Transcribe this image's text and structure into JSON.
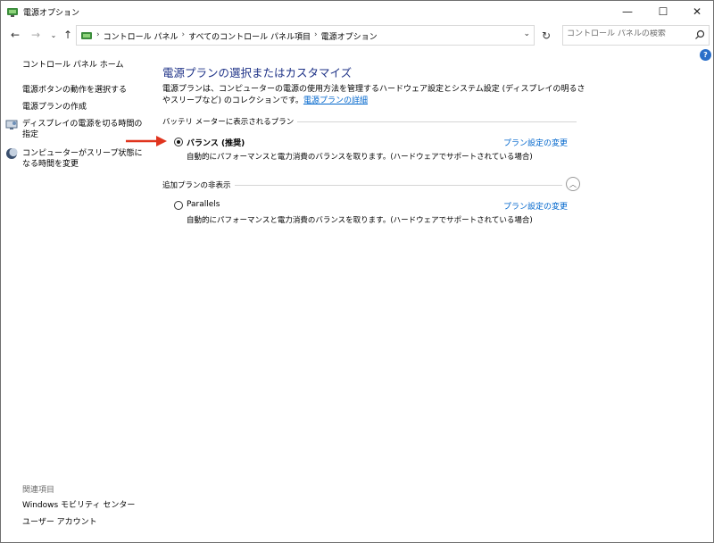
{
  "window": {
    "title": "電源オプション",
    "minimize_glyph": "—",
    "maximize_glyph": "☐",
    "close_glyph": "✕"
  },
  "nav": {
    "back_glyph": "←",
    "forward_glyph": "→",
    "recent_glyph": "⌄",
    "up_glyph": "↑",
    "refresh_glyph": "↻",
    "dropdown_glyph": "⌄"
  },
  "address": {
    "breadcrumbs": [
      "コントロール パネル",
      "すべてのコントロール パネル項目",
      "電源オプション"
    ],
    "separator": "›"
  },
  "search": {
    "placeholder": "コントロール パネルの検索"
  },
  "help": {
    "label": "?"
  },
  "sidebar": {
    "home": "コントロール パネル ホーム",
    "items": [
      {
        "label": "電源ボタンの動作を選択する"
      },
      {
        "label": "電源プランの作成"
      },
      {
        "label": "ディスプレイの電源を切る時間の指定"
      },
      {
        "label": "コンピューターがスリープ状態になる時間を変更"
      }
    ],
    "see_also": {
      "title": "関連項目",
      "items": [
        {
          "label": "Windows モビリティ センター"
        },
        {
          "label": "ユーザー アカウント"
        }
      ]
    }
  },
  "main": {
    "heading": "電源プランの選択またはカスタマイズ",
    "description": "電源プランは、コンピューターの電源の使用方法を管理するハードウェア設定とシステム設定 (ディスプレイの明るさやスリープなど) のコレクションです。",
    "description_link": "電源プランの詳細",
    "battery_section_label": "バッテリ メーターに表示されるプラン",
    "additional_section_label": "追加プランの非表示",
    "collapse_glyph": "︿",
    "plans": [
      {
        "name": "バランス (推奨)",
        "description": "自動的にパフォーマンスと電力消費のバランスを取ります。(ハードウェアでサポートされている場合)",
        "change_link": "プラン設定の変更",
        "selected": true
      },
      {
        "name": "Parallels",
        "description": "自動的にパフォーマンスと電力消費のバランスを取ります。(ハードウェアでサポートされている場合)",
        "change_link": "プラン設定の変更",
        "selected": false
      }
    ]
  },
  "colors": {
    "heading": "#1e3287",
    "link": "#0066cc",
    "arrow": "#e0341e",
    "help": "#2b6fc9"
  }
}
